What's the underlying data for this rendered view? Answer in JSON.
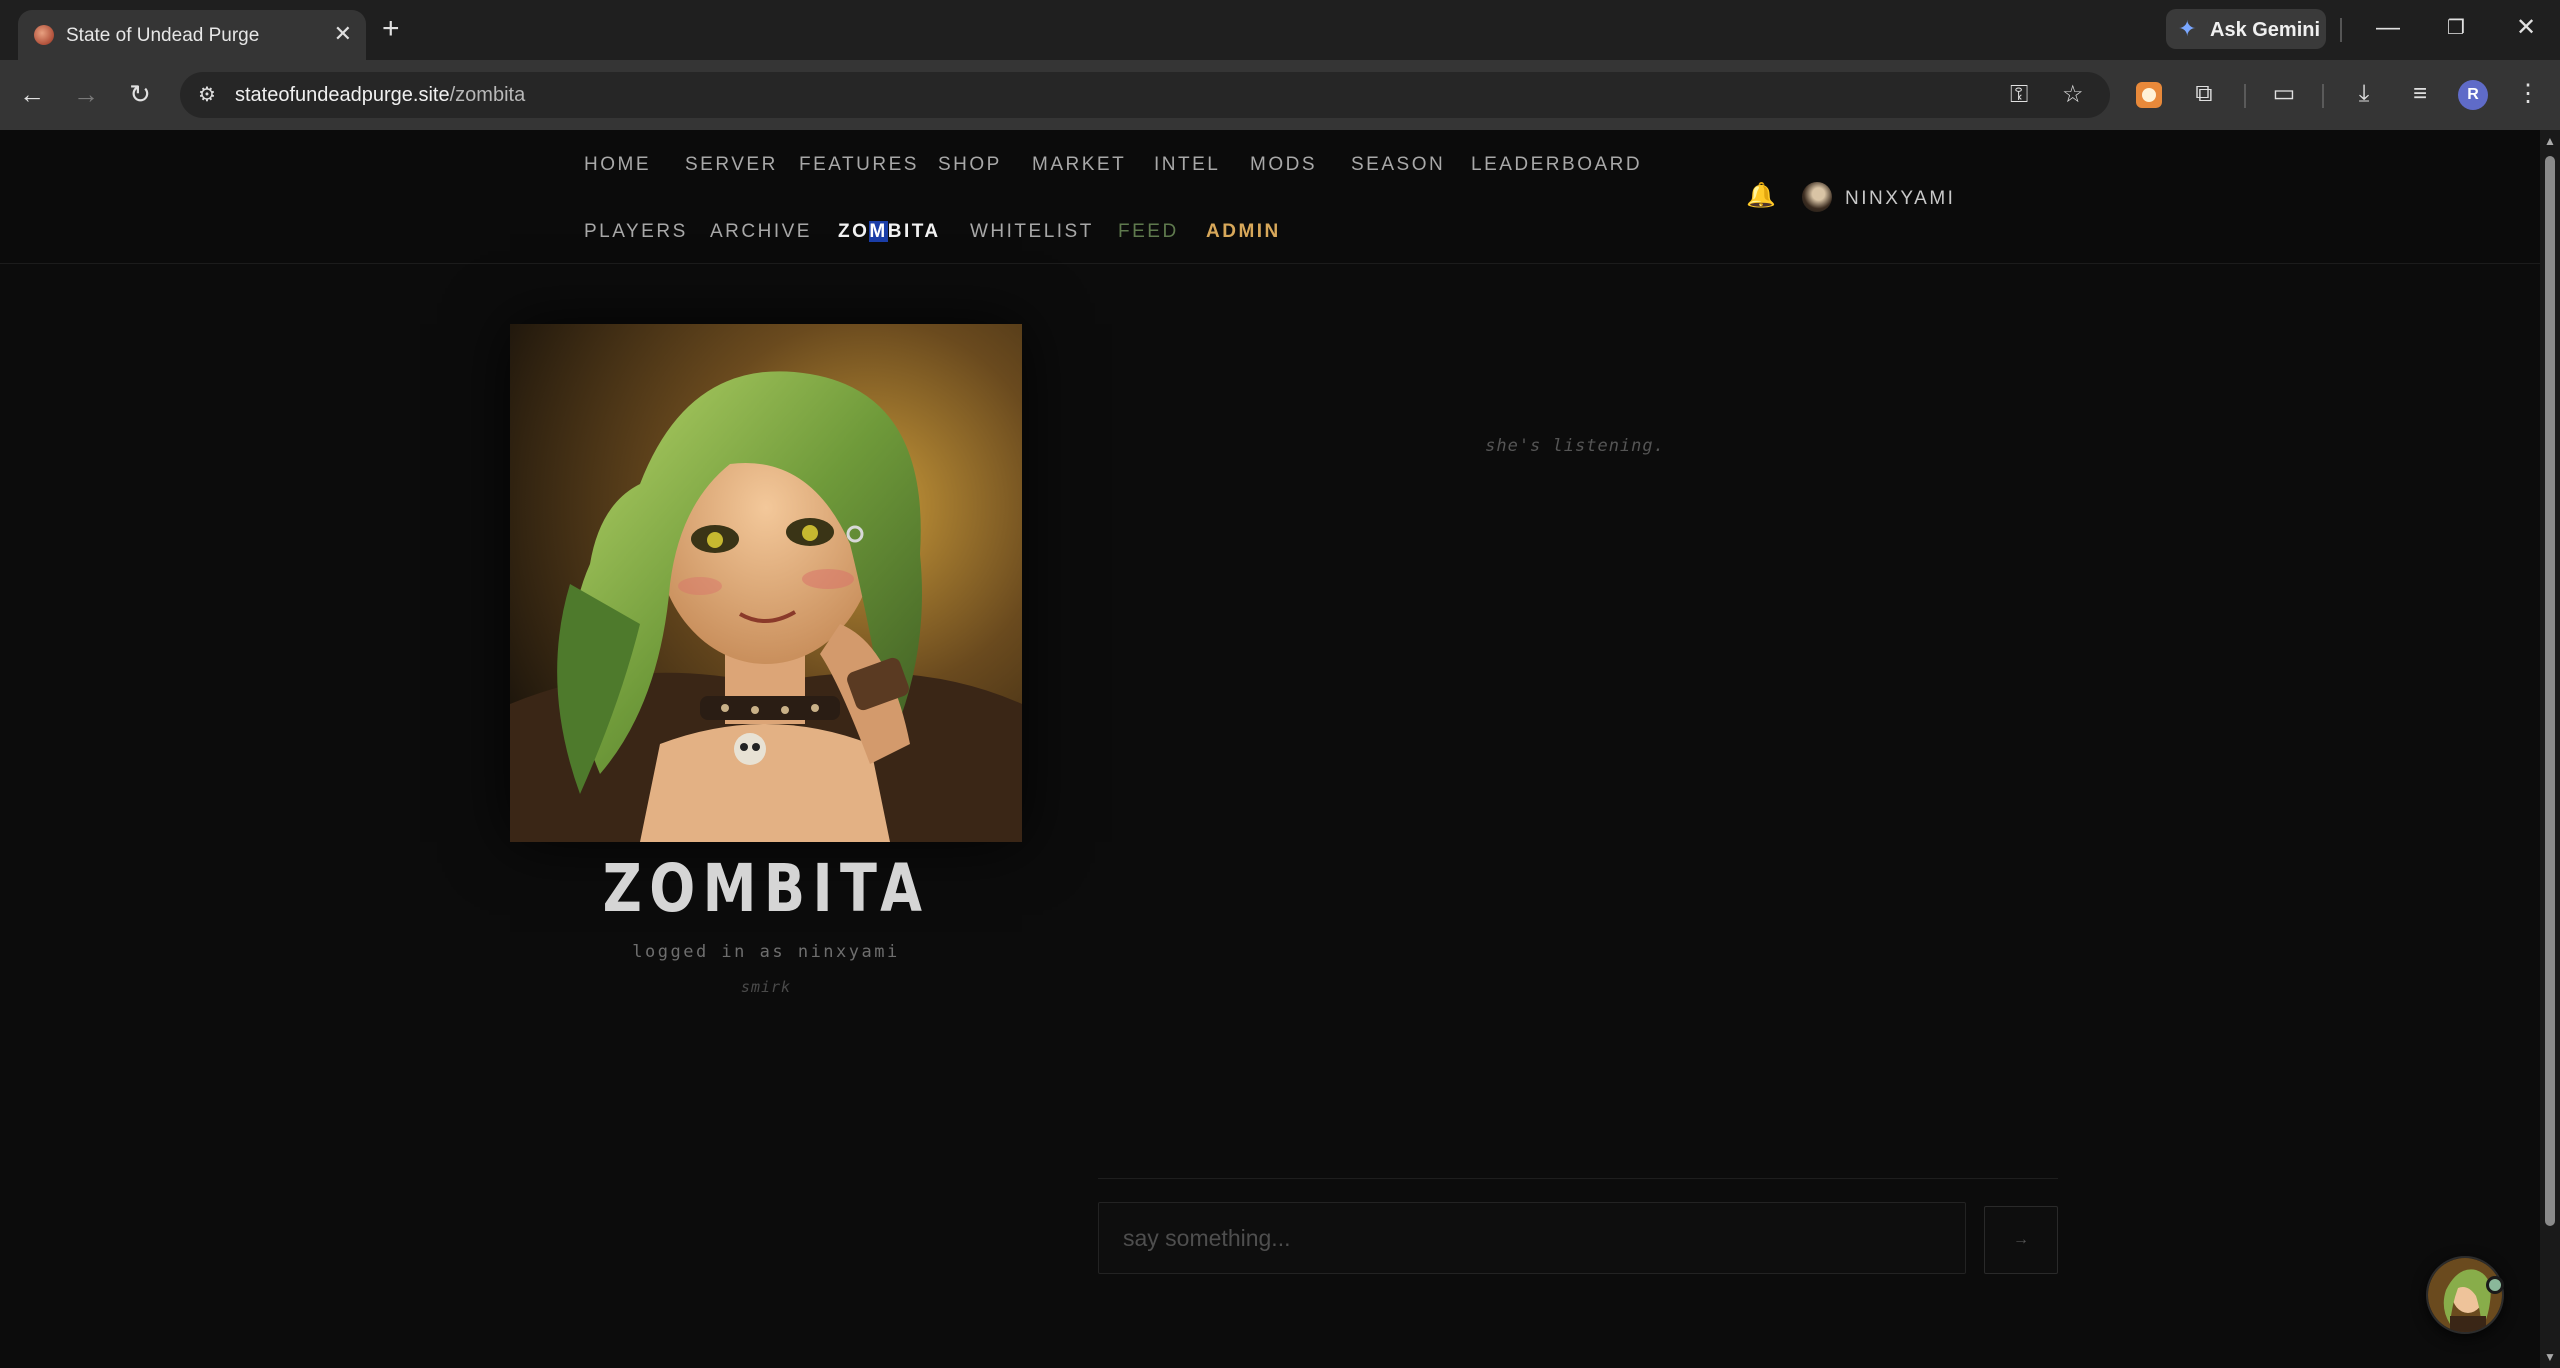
{
  "browser": {
    "tab_title": "State of Undead Purge",
    "tab_close": "✕",
    "new_tab": "+",
    "ask_gemini": "Ask Gemini",
    "url_host": "stateofundeadpurge.site",
    "url_path": "/zombita",
    "profile_initial": "R"
  },
  "nav": {
    "row1": [
      "HOME",
      "SERVER",
      "FEATURES",
      "SHOP",
      "MARKET",
      "INTEL",
      "MODS",
      "SEASON",
      "LEADERBOARD"
    ],
    "row2": {
      "players": "PLAYERS",
      "archive": "ARCHIVE",
      "zombita_pre": "ZO",
      "zombita_hl": "M",
      "zombita_post": "BITA",
      "whitelist": "WHITELIST",
      "feed": "FEED",
      "admin": "ADMIN"
    },
    "username": "NINXYAMI"
  },
  "profile": {
    "name": "ZOMBITA",
    "logged_in": "logged in as ninxyami",
    "mood": "smirk"
  },
  "chat": {
    "status": "she's listening.",
    "placeholder": "say something...",
    "send_label": "→"
  },
  "colors": {
    "accent_admin": "#d8a85a",
    "feed": "#5f7a4e",
    "active_highlight": "#1b3ea8",
    "bell": "#e5b02b"
  },
  "icons": [
    "back-arrow-icon",
    "forward-arrow-icon",
    "reload-icon",
    "site-info-icon",
    "key-icon",
    "star-icon",
    "extension-icon",
    "puzzle-icon",
    "media-icon",
    "download-icon",
    "playlist-icon",
    "menu-kebab-icon",
    "bell-icon"
  ]
}
